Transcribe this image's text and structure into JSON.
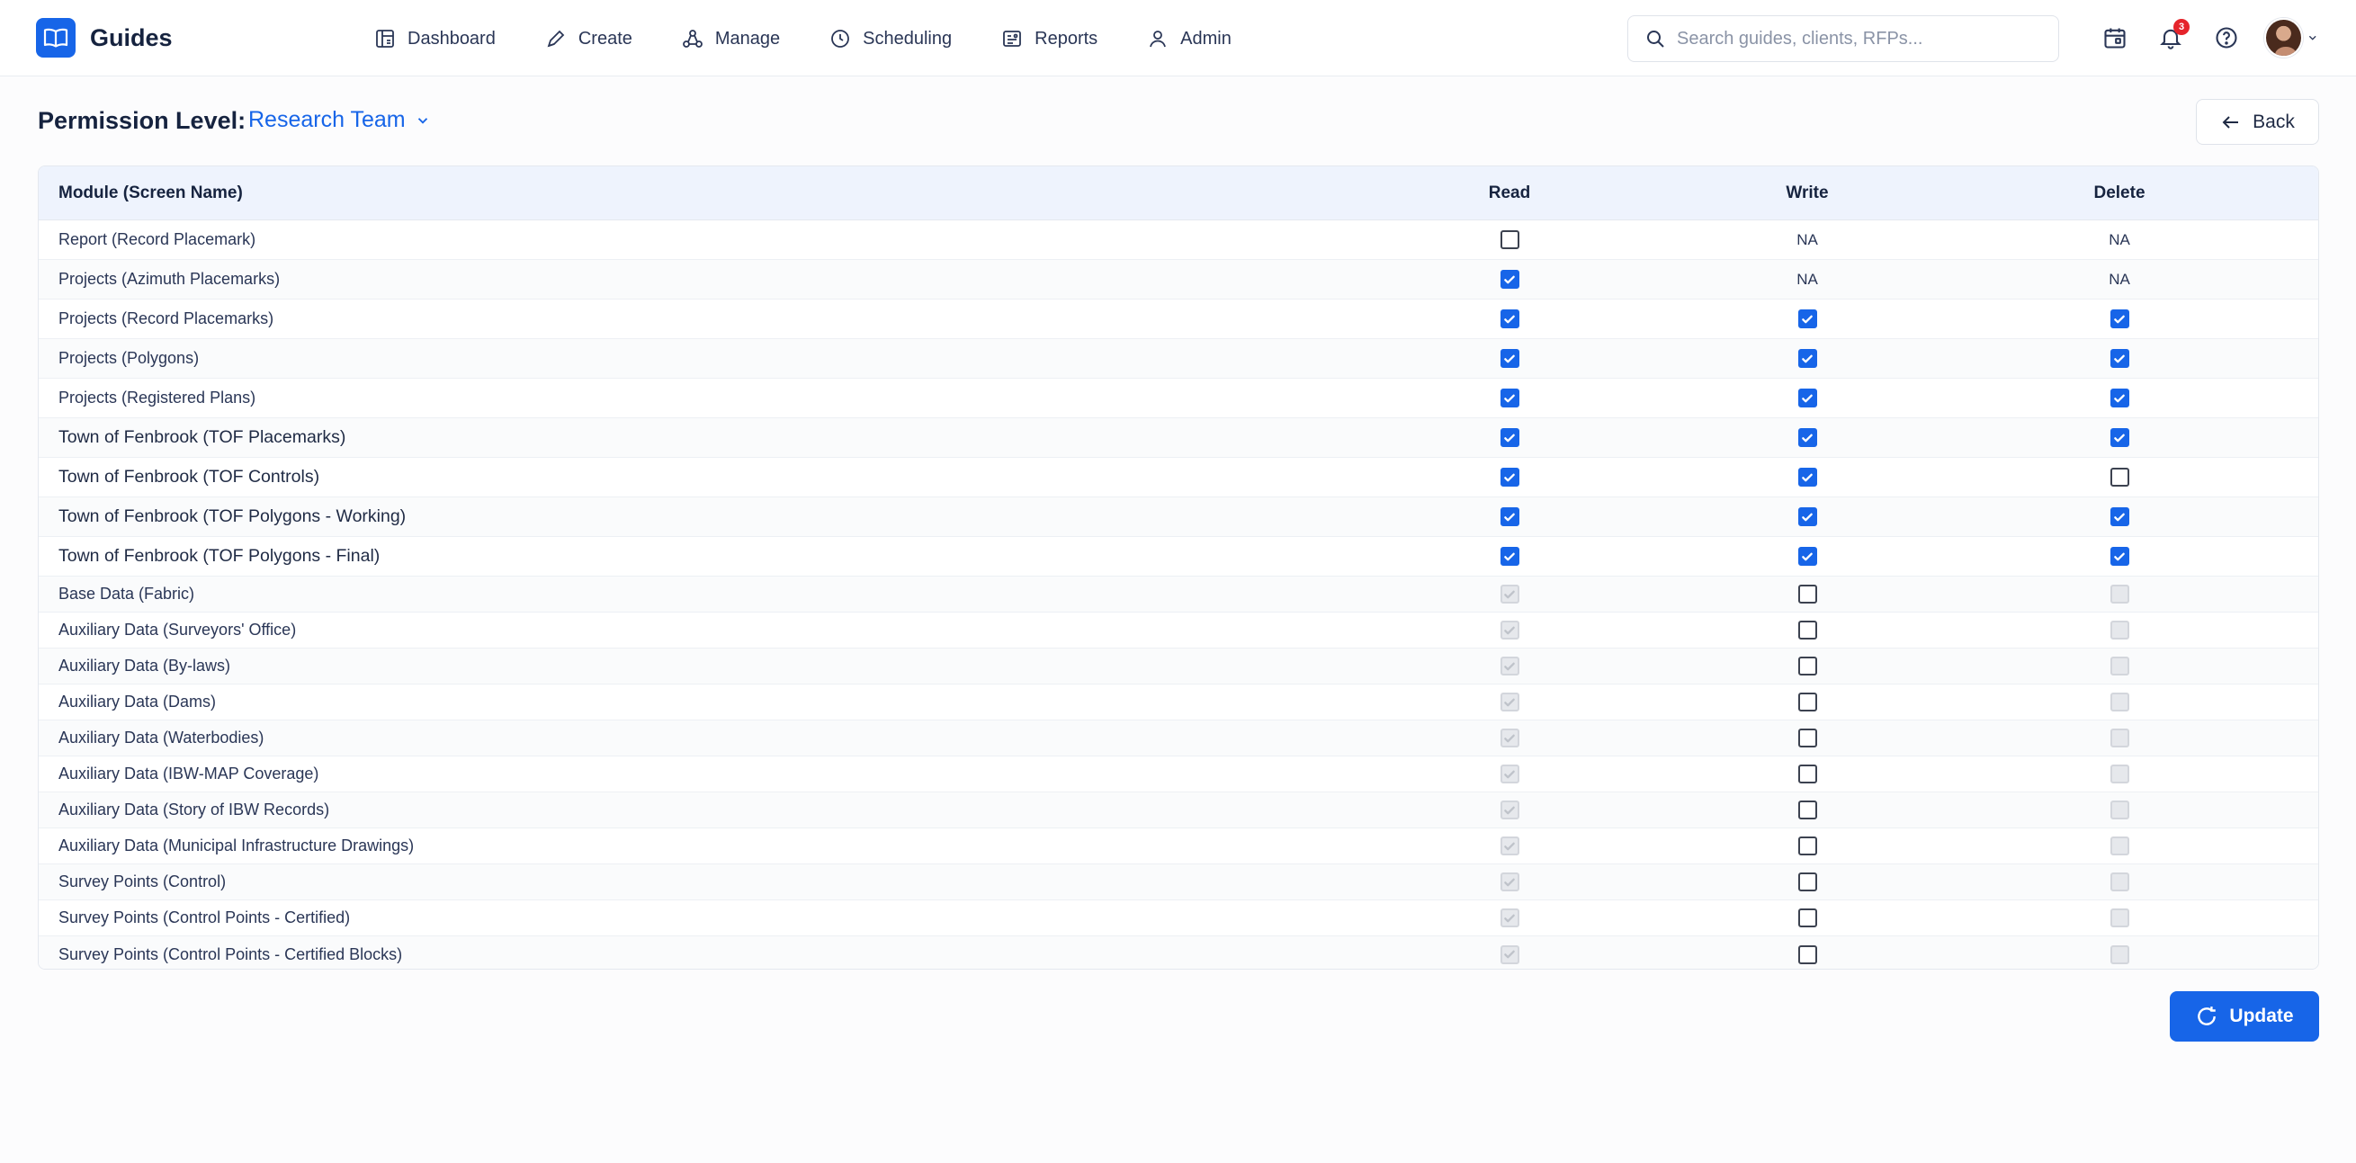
{
  "app": {
    "name": "Guides"
  },
  "nav": [
    {
      "label": "Dashboard",
      "icon": "dashboard-icon"
    },
    {
      "label": "Create",
      "icon": "pencil-icon"
    },
    {
      "label": "Manage",
      "icon": "manage-icon"
    },
    {
      "label": "Scheduling",
      "icon": "clock-icon"
    },
    {
      "label": "Reports",
      "icon": "reports-icon"
    },
    {
      "label": "Admin",
      "icon": "user-icon"
    }
  ],
  "search": {
    "placeholder": "Search guides, clients, RFPs...",
    "value": ""
  },
  "notifications": {
    "count": "3"
  },
  "page": {
    "permission_label": "Permission Level:",
    "permission_value": "Research Team",
    "back_label": "Back",
    "update_label": "Update"
  },
  "table": {
    "headers": {
      "module": "Module (Screen Name)",
      "read": "Read",
      "write": "Write",
      "delete": "Delete"
    },
    "rows": [
      {
        "module": "Report (Record Placemark)",
        "read": "unchecked",
        "write": "NA",
        "delete": "NA"
      },
      {
        "module": "Projects (Azimuth Placemarks)",
        "read": "checked",
        "write": "NA",
        "delete": "NA"
      },
      {
        "module": "Projects (Record Placemarks)",
        "read": "checked",
        "write": "checked",
        "delete": "checked"
      },
      {
        "module": "Projects (Polygons)",
        "read": "checked",
        "write": "checked",
        "delete": "checked"
      },
      {
        "module": "Projects (Registered Plans)",
        "read": "checked",
        "write": "checked",
        "delete": "checked"
      },
      {
        "module": "Town of Fenbrook (TOF Placemarks)",
        "read": "checked",
        "write": "checked",
        "delete": "checked"
      },
      {
        "module": "Town of Fenbrook (TOF Controls)",
        "read": "checked",
        "write": "checked",
        "delete": "unchecked"
      },
      {
        "module": "Town of Fenbrook (TOF Polygons - Working)",
        "read": "checked",
        "write": "checked",
        "delete": "checked"
      },
      {
        "module": "Town of Fenbrook (TOF Polygons - Final)",
        "read": "checked",
        "write": "checked",
        "delete": "checked"
      },
      {
        "module": "Base Data (Fabric)",
        "read": "disabled-checked",
        "write": "unchecked",
        "delete": "disabled"
      },
      {
        "module": "Auxiliary Data (Surveyors' Office)",
        "read": "disabled-checked",
        "write": "unchecked",
        "delete": "disabled"
      },
      {
        "module": "Auxiliary Data (By-laws)",
        "read": "disabled-checked",
        "write": "unchecked",
        "delete": "disabled"
      },
      {
        "module": "Auxiliary Data (Dams)",
        "read": "disabled-checked",
        "write": "unchecked",
        "delete": "disabled"
      },
      {
        "module": "Auxiliary Data (Waterbodies)",
        "read": "disabled-checked",
        "write": "unchecked",
        "delete": "disabled"
      },
      {
        "module": "Auxiliary Data (IBW-MAP Coverage)",
        "read": "disabled-checked",
        "write": "unchecked",
        "delete": "disabled"
      },
      {
        "module": "Auxiliary Data (Story of IBW Records)",
        "read": "disabled-checked",
        "write": "unchecked",
        "delete": "disabled"
      },
      {
        "module": "Auxiliary Data (Municipal Infrastructure Drawings)",
        "read": "disabled-checked",
        "write": "unchecked",
        "delete": "disabled"
      },
      {
        "module": "Survey Points (Control)",
        "read": "disabled-checked",
        "write": "unchecked",
        "delete": "disabled"
      },
      {
        "module": "Survey Points (Control Points - Certified)",
        "read": "disabled-checked",
        "write": "unchecked",
        "delete": "disabled"
      },
      {
        "module": "Survey Points (Control Points - Certified Blocks)",
        "read": "disabled-checked",
        "write": "unchecked",
        "delete": "disabled"
      }
    ]
  },
  "colors": {
    "accent": "#1765e8",
    "badge": "#e5242b",
    "header_bg": "#eef3fd"
  }
}
